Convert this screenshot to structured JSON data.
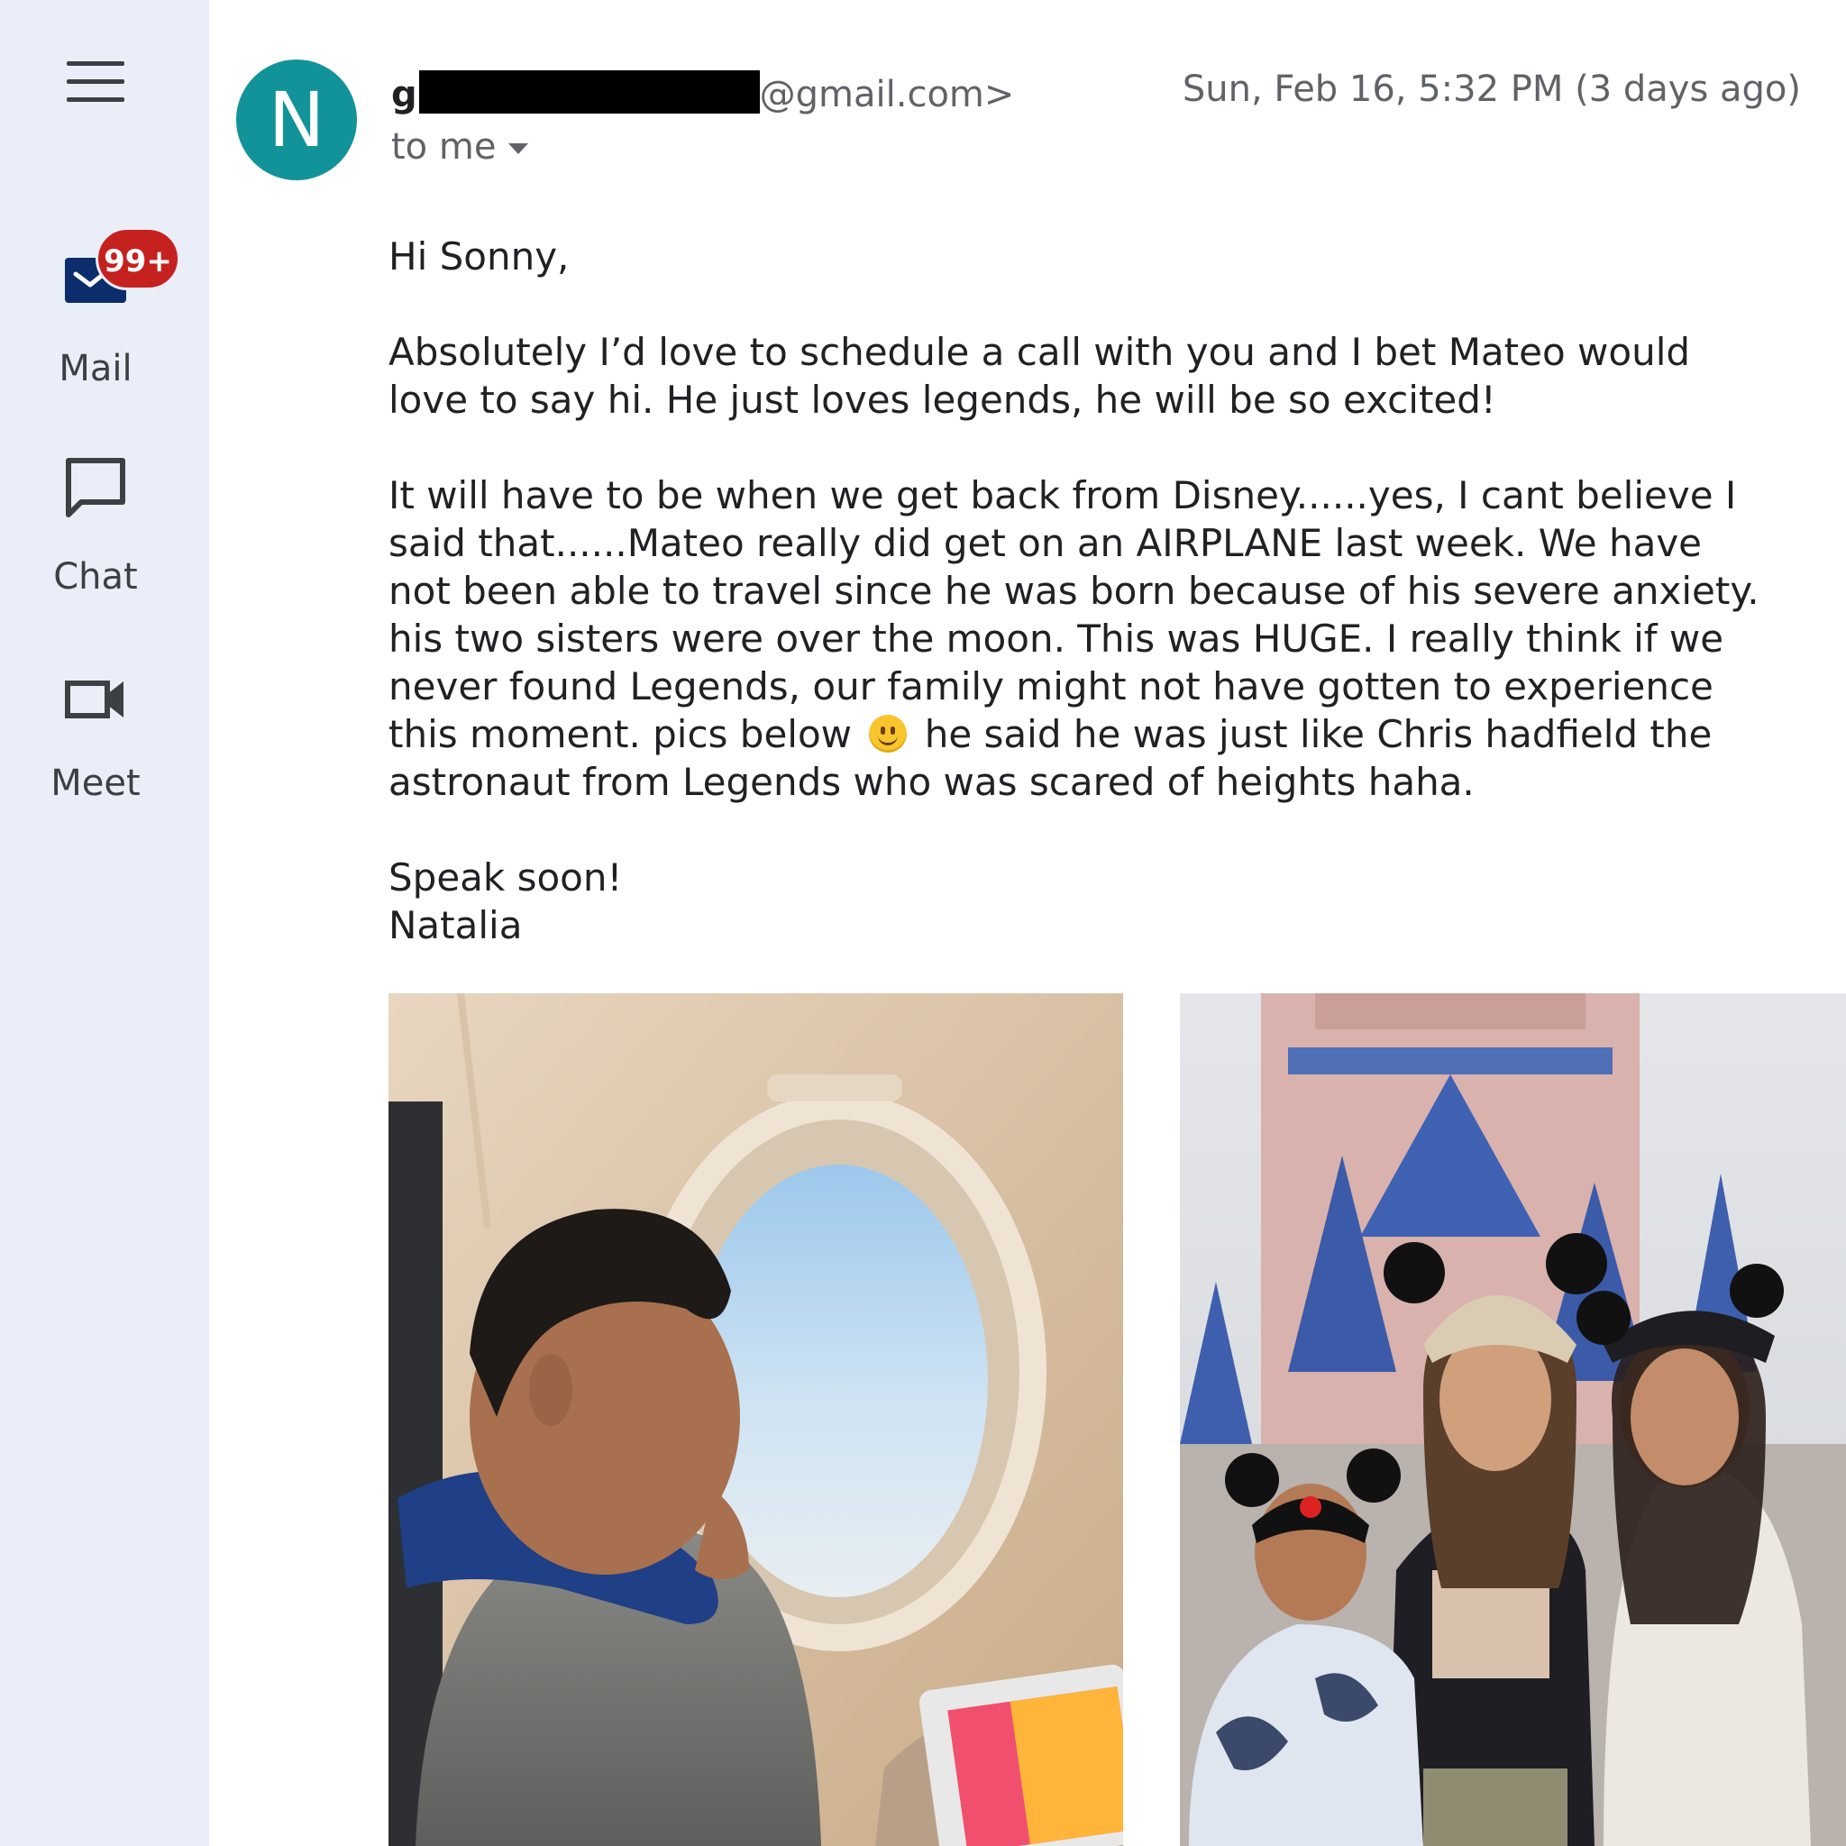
{
  "sidebar": {
    "items": [
      {
        "label": "Mail",
        "badge": "99+"
      },
      {
        "label": "Chat"
      },
      {
        "label": "Meet"
      }
    ]
  },
  "email": {
    "avatar_letter": "N",
    "sender_prefix": "g",
    "sender_domain": "@gmail.com>",
    "date": "Sun, Feb 16, 5:32 PM (3 days ago)",
    "recipient": "to me",
    "greeting": "Hi Sonny,",
    "para1": "Absolutely I’d love to schedule a call with you and I bet Mateo would love to say hi. He just loves legends, he will be so excited!",
    "para2_a": "It will have to be when we get back from Disney......yes, I cant believe I said that......Mateo really did get on an AIRPLANE last week. We have not been able to travel since he was born because of his severe anxiety. his two sisters were over the moon. This was HUGE. I really think if we never found Legends, our family might not have gotten to experience this moment. pics below",
    "para2_b": "he said he was just like Chris hadfield the astronaut from Legends who was scared of heights haha.",
    "closing": "Speak soon!",
    "signature": "Natalia"
  },
  "colors": {
    "rail": "#e9eef8",
    "avatar": "#12939a",
    "badge": "#c5221f",
    "mail_icon": "#0b2d6b"
  },
  "icons": [
    "hamburger-menu-icon",
    "mail-icon",
    "chat-icon",
    "video-camera-icon",
    "smiley-emoji-icon"
  ]
}
